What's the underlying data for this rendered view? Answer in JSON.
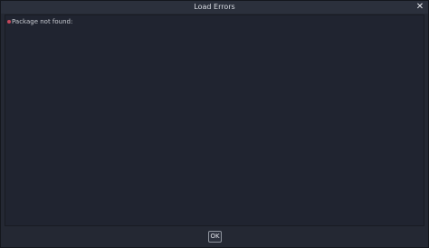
{
  "window": {
    "title": "Load Errors",
    "close_glyph": "✕"
  },
  "errors": {
    "items": [
      {
        "text": "Package not found:",
        "icon": "error-bullet-icon",
        "color": "#c4475a"
      }
    ]
  },
  "footer": {
    "ok_label": "OK"
  }
}
